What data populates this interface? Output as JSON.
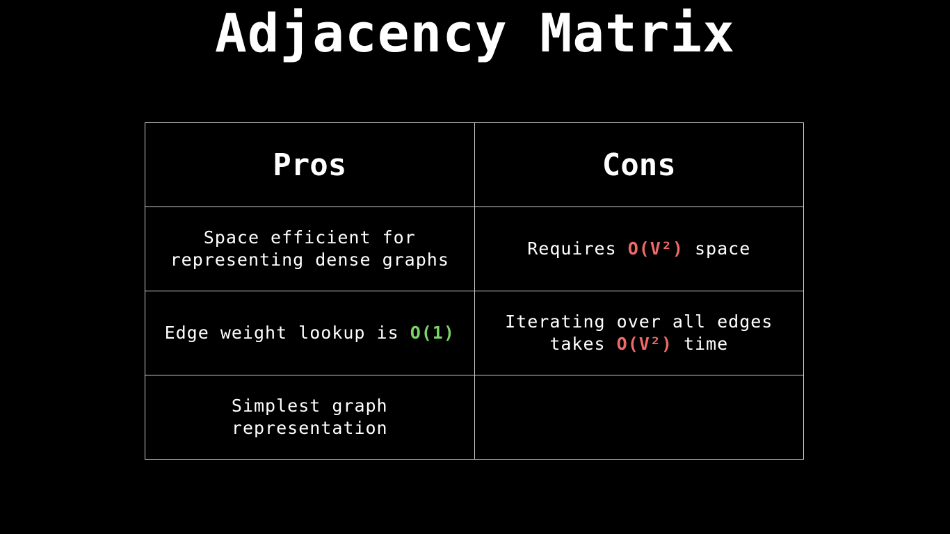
{
  "title": "Adjacency Matrix",
  "colors": {
    "background": "#000000",
    "text": "#ffffff",
    "border": "#cfcfcf",
    "good": "#7cd36a",
    "bad": "#f06a6a"
  },
  "table": {
    "headers": {
      "pros": "Pros",
      "cons": "Cons"
    },
    "rows": [
      {
        "pro": {
          "line1": "Space efficient for",
          "line2": "representing dense graphs"
        },
        "con": {
          "pre": "Requires ",
          "highlight": "O(V²)",
          "post": " space"
        }
      },
      {
        "pro": {
          "pre": "Edge weight lookup is ",
          "highlight": "O(1)"
        },
        "con": {
          "line1": "Iterating over all edges",
          "pre2": "takes ",
          "highlight": "O(V²)",
          "post2": " time"
        }
      },
      {
        "pro": {
          "line1": "Simplest graph",
          "line2": "representation"
        },
        "con": {
          "text": ""
        }
      }
    ]
  }
}
